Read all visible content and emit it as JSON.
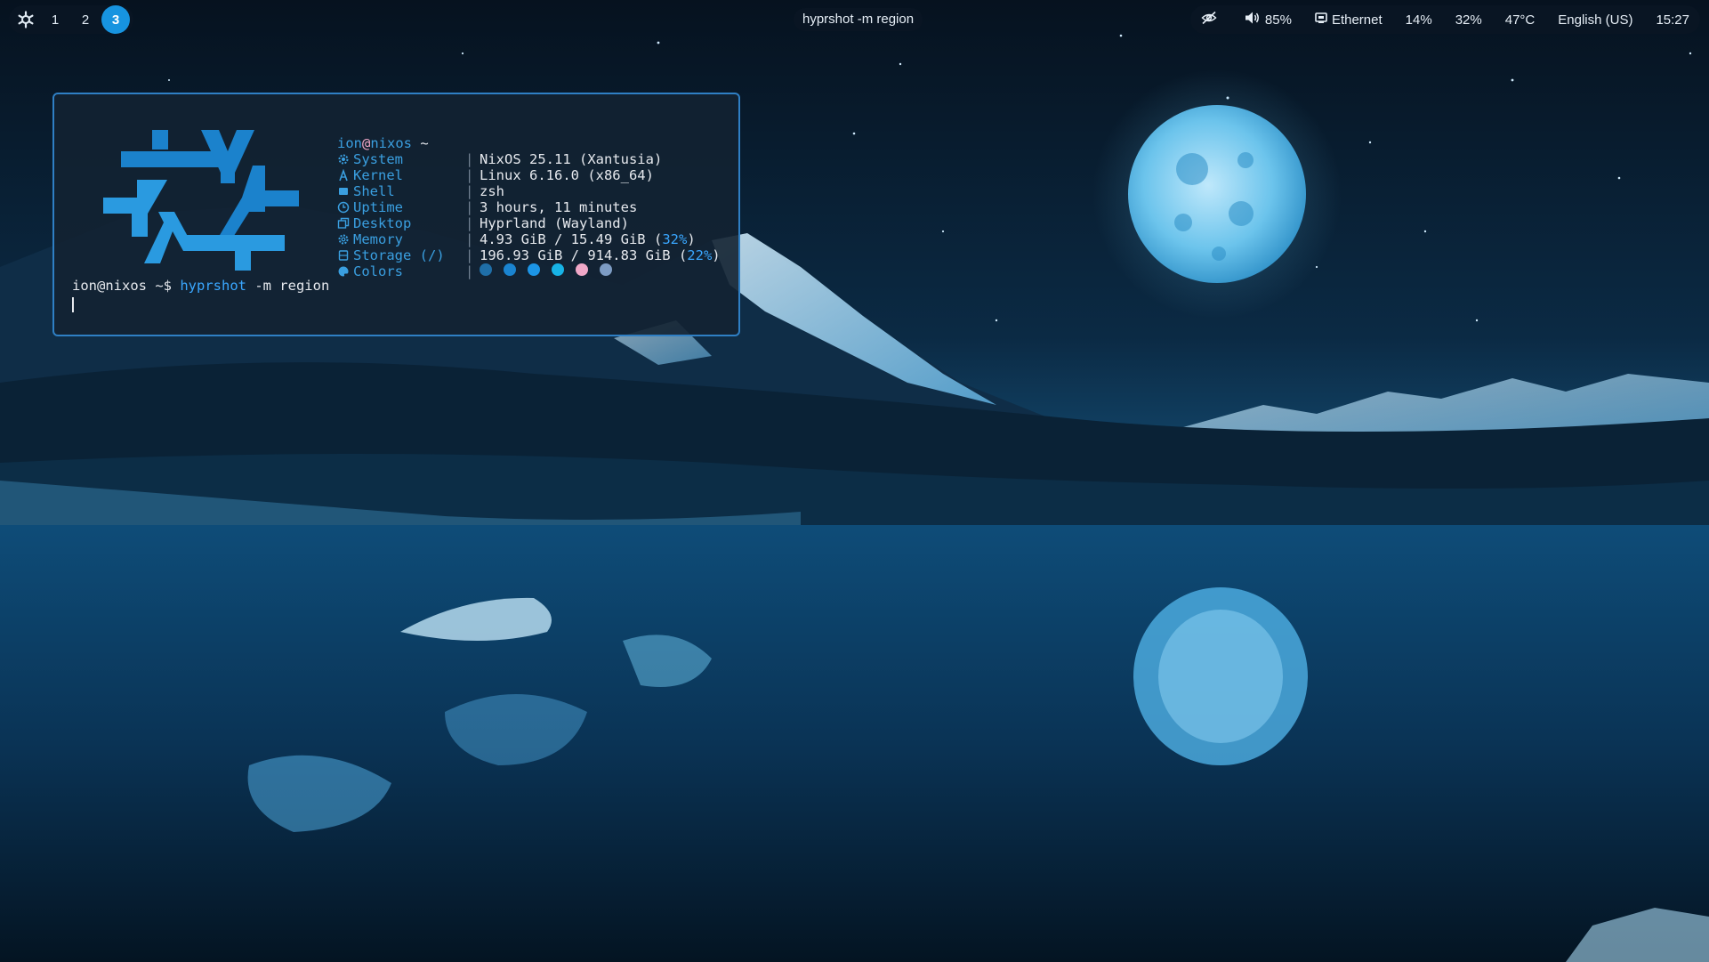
{
  "wallpaper": {
    "description_colors": [
      "#071624",
      "#1a6fa8",
      "#7fd0f5"
    ]
  },
  "topbar": {
    "launcher_icon": "nixos-snowflake-icon",
    "workspaces": [
      {
        "label": "1",
        "active": false
      },
      {
        "label": "2",
        "active": false
      },
      {
        "label": "3",
        "active": true
      }
    ],
    "window_title": "hyprshot -m region",
    "status": {
      "idle_icon": "eye-off-icon",
      "volume_icon": "speaker-icon",
      "volume": "85%",
      "network_icon": "ethernet-icon",
      "network": "Ethernet",
      "cpu": "14%",
      "memory": "32%",
      "temperature": "47°C",
      "keyboard_layout": "English (US)",
      "clock": "15:27"
    },
    "accent_color": "#1794e0"
  },
  "terminal": {
    "header": {
      "user": "ion",
      "at": "@",
      "host": "nixos",
      "suffix": " ~"
    },
    "fetch": [
      {
        "icon": "gear-icon",
        "key": "System",
        "value": "NixOS 25.11 (Xantusia)"
      },
      {
        "icon": "kernel-icon",
        "key": "Kernel",
        "value": "Linux 6.16.0 (x86_64)"
      },
      {
        "icon": "terminal-icon",
        "key": "Shell",
        "value": "zsh"
      },
      {
        "icon": "clock-icon",
        "key": "Uptime",
        "value": "3 hours, 11 minutes"
      },
      {
        "icon": "window-icon",
        "key": "Desktop",
        "value": "Hyprland (Wayland)"
      },
      {
        "icon": "chip-icon",
        "key": "Memory",
        "value": "4.93 GiB / 15.49 GiB (",
        "pct": "32%",
        "tail": ")"
      },
      {
        "icon": "disk-icon",
        "key": "Storage (/)",
        "value": "196.93 GiB / 914.83 GiB (",
        "pct": "22%",
        "tail": ")"
      },
      {
        "icon": "palette-icon",
        "key": "Colors",
        "value": ""
      }
    ],
    "separator": "|",
    "color_swatches": [
      "#1f6fa8",
      "#1a84d0",
      "#1c95e6",
      "#17b3e6",
      "#f0a8c8",
      "#7d9cc4"
    ],
    "prompt": {
      "text": "ion@nixos ~$ ",
      "command": "hyprshot",
      "args": " -m region"
    },
    "border_color": "#2f7fc4"
  }
}
